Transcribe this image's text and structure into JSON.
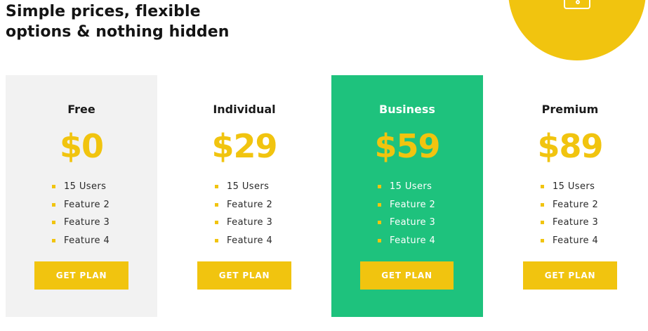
{
  "header": {
    "title_line1": "Simple prices, flexible",
    "title_line2": "options & nothing hidden"
  },
  "decoration": {
    "icon": "card-icon",
    "accent": "#f1c40f"
  },
  "plans": [
    {
      "name": "Free",
      "price": "$0",
      "features": [
        "15 Users",
        "Feature 2",
        "Feature 3",
        "Feature 4"
      ],
      "cta": "GET PLAN",
      "background": "#f2f2f2"
    },
    {
      "name": "Individual",
      "price": "$29",
      "features": [
        "15 Users",
        "Feature 2",
        "Feature 3",
        "Feature 4"
      ],
      "cta": "GET PLAN",
      "background": "#ffffff"
    },
    {
      "name": "Business",
      "price": "$59",
      "features": [
        "15 Users",
        "Feature 2",
        "Feature 3",
        "Feature 4"
      ],
      "cta": "GET PLAN",
      "background": "#1ec27d",
      "highlighted": true
    },
    {
      "name": "Premium",
      "price": "$89",
      "features": [
        "15 Users",
        "Feature 2",
        "Feature 3",
        "Feature 4"
      ],
      "cta": "GET PLAN",
      "background": "#ffffff"
    }
  ]
}
